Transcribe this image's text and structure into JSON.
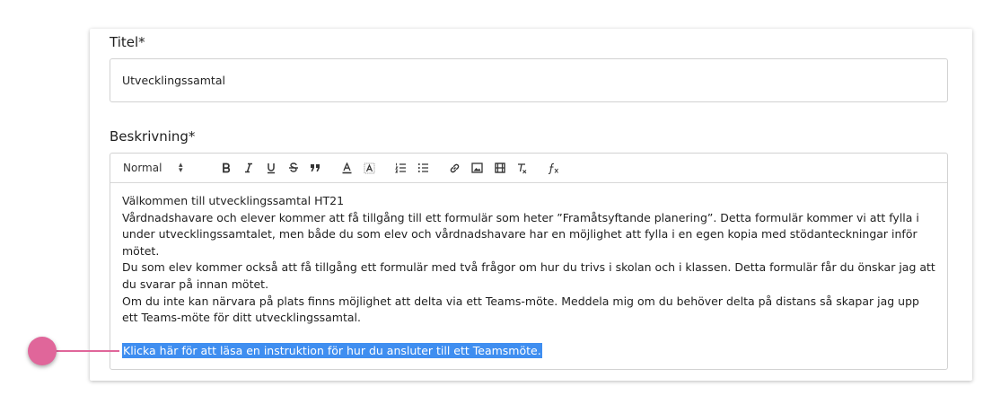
{
  "title_field": {
    "label": "Titel*",
    "value": "Utvecklingssamtal"
  },
  "description_field": {
    "label": "Beskrivning*",
    "toolbar": {
      "format_value": "Normal",
      "buttons": [
        "bold-icon",
        "italic-icon",
        "underline-icon",
        "strikethrough-icon",
        "blockquote-icon",
        "text-color-icon",
        "background-color-icon",
        "ordered-list-icon",
        "bullet-list-icon",
        "link-icon",
        "image-icon",
        "video-icon",
        "clear-format-icon",
        "formula-icon"
      ]
    },
    "content": {
      "line1": "Välkommen till utvecklingssamtal HT21",
      "line2": "Vårdnadshavare och elever kommer att få tillgång till ett formulär som heter ”Framåtsyftande planering”. Detta formulär kommer vi att fylla i under utvecklingssamtalet, men både du som elev och vårdnadshavare har en möjlighet att fylla i en egen kopia med stödanteckningar inför mötet.",
      "line3": "Du som elev kommer också att få tillgång ett formulär med två frågor om hur du trivs i skolan och i klassen. Detta formulär får du önskar jag att du svarar på innan mötet.",
      "line4": "Om du inte kan närvara på plats finns möjlighet att delta via ett Teams-möte. Meddela mig om du behöver delta på distans så skapar jag upp ett Teams-möte för ditt utvecklingssamtal.",
      "link_text": "Klicka här för att läsa en instruktion för hur du ansluter till ett Teamsmöte."
    }
  },
  "colors": {
    "highlight": "#3f8ef0",
    "pointer": "#e0669a",
    "border": "#d2d2d2"
  }
}
